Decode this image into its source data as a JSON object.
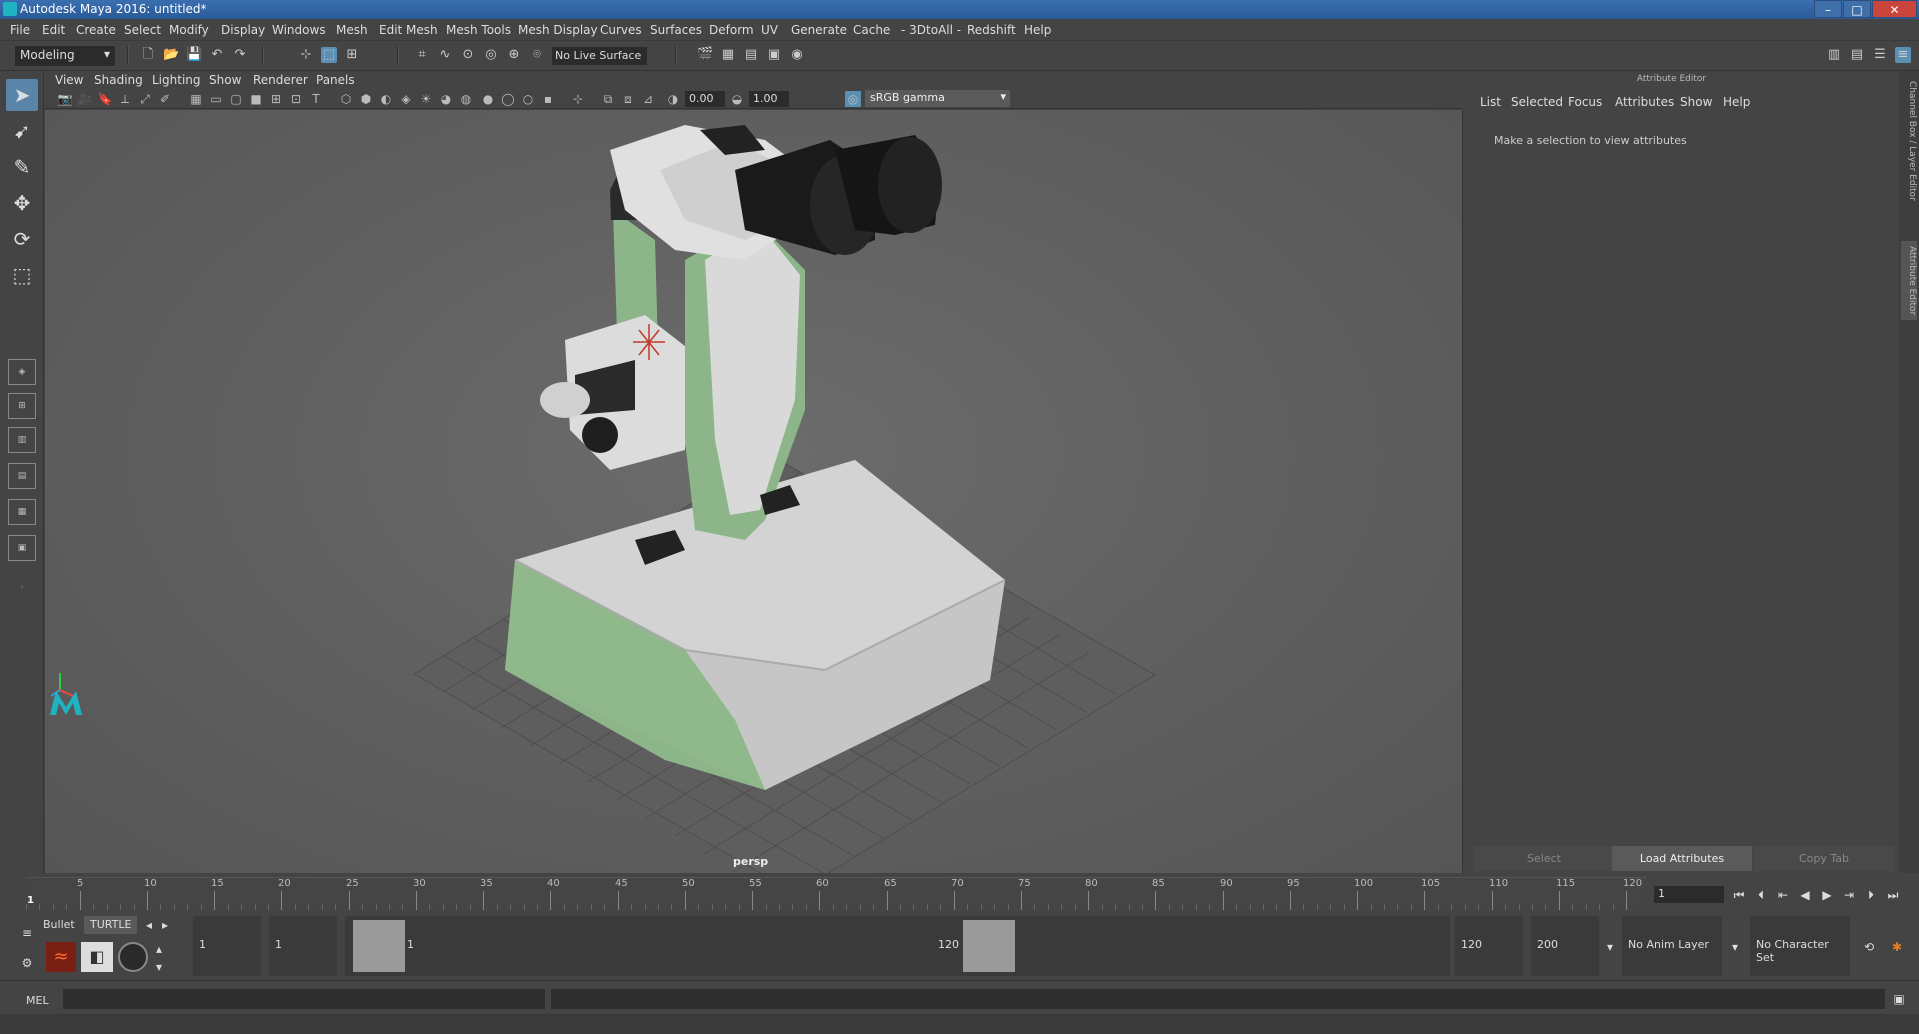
{
  "window": {
    "title": "Autodesk Maya 2016: untitled*",
    "min": "–",
    "max": "□",
    "close": "✕"
  },
  "menubar": [
    "File",
    "Edit",
    "Create",
    "Select",
    "Modify",
    "Display",
    "Windows",
    "Mesh",
    "Edit Mesh",
    "Mesh Tools",
    "Mesh Display",
    "Curves",
    "Surfaces",
    "Deform",
    "UV",
    "Generate",
    "Cache",
    "- 3DtoAll -",
    "Redshift",
    "Help"
  ],
  "statusline": {
    "mode": "Modeling",
    "live_surface": "No Live Surface"
  },
  "viewport": {
    "menu": [
      "View",
      "Shading",
      "Lighting",
      "Show",
      "Renderer",
      "Panels"
    ],
    "exposure": "0.00",
    "gamma_value": "1.00",
    "color_space": "sRGB gamma",
    "camera_label": "persp"
  },
  "attribute_editor": {
    "title": "Attribute Editor",
    "menu": [
      "List",
      "Selected",
      "Focus",
      "Attributes",
      "Show",
      "Help"
    ],
    "message": "Make a selection to view attributes",
    "buttons": {
      "select": "Select",
      "load": "Load Attributes",
      "copy": "Copy Tab"
    }
  },
  "side_tabs": {
    "channel_box": "Channel Box / Layer Editor",
    "attribute_editor": "Attribute Editor"
  },
  "timeline": {
    "ticks": [
      "5",
      "10",
      "15",
      "20",
      "25",
      "30",
      "35",
      "40",
      "45",
      "50",
      "55",
      "60",
      "65",
      "70",
      "75",
      "80",
      "85",
      "90",
      "95",
      "100",
      "105",
      "110",
      "115",
      "120"
    ],
    "start_label": "1",
    "current_frame": "1"
  },
  "range": {
    "shelf_tabs": [
      "Bullet",
      "TURTLE"
    ],
    "start_frame": "1",
    "playback_start": "1",
    "slider_start": "1",
    "slider_end": "120",
    "playback_end": "120",
    "end_frame": "200",
    "anim_layer": "No Anim Layer",
    "character_set": "No Character Set"
  },
  "command_line": {
    "label": "MEL"
  },
  "colors": {
    "background": "#444444",
    "viewport": "#636363",
    "accent": "#5c8fb4",
    "model_green": "#8db58a",
    "model_grey": "#d6d6d6",
    "title_blue": "#2f63a3"
  },
  "icons": [
    "select-tool-icon",
    "lasso-tool-icon",
    "paint-tool-icon",
    "move-tool-icon",
    "rotate-tool-icon",
    "scale-tool-icon",
    "maya-logo-icon"
  ]
}
